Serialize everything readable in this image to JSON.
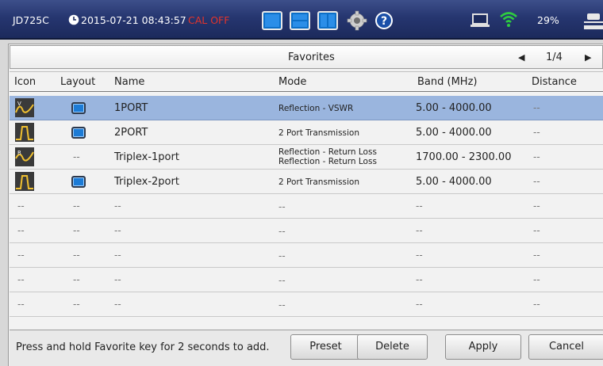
{
  "statusbar": {
    "model": "JD725C",
    "datetime": "2015-07-21 08:43:57",
    "cal_status": "CAL OFF",
    "battery": "29%",
    "icons": [
      "clock-icon",
      "layout-single-icon",
      "layout-split-horizontal-icon",
      "layout-split-vertical-icon",
      "gear-icon",
      "help-icon",
      "laptop-icon",
      "wifi-icon",
      "power-icon"
    ],
    "accent_color": "#1c2a5c",
    "wifi_color": "#2ecc40",
    "cal_color": "#e3342b"
  },
  "favorites": {
    "title": "Favorites",
    "page": "1/4"
  },
  "table": {
    "headers": [
      "Icon",
      "Layout",
      "Name",
      "Mode",
      "Band (MHz)",
      "Distance"
    ],
    "rows": [
      {
        "icon": "vswr-icon",
        "layout": "single",
        "name": "1PORT",
        "mode": [
          "Reflection - VSWR"
        ],
        "band": "5.00 - 4000.00",
        "distance": "--",
        "selected": true
      },
      {
        "icon": "transmission-icon",
        "layout": "single",
        "name": "2PORT",
        "mode": [
          "2 Port Transmission"
        ],
        "band": "5.00 - 4000.00",
        "distance": "--",
        "selected": false
      },
      {
        "icon": "return-loss-icon",
        "layout": "--",
        "name": "Triplex-1port",
        "mode": [
          "Reflection - Return Loss",
          "Reflection - Return Loss"
        ],
        "band": "1700.00 - 2300.00",
        "distance": "--",
        "selected": false
      },
      {
        "icon": "transmission-icon",
        "layout": "single",
        "name": "Triplex-2port",
        "mode": [
          "2 Port Transmission"
        ],
        "band": "5.00 - 4000.00",
        "distance": "--",
        "selected": false
      },
      {
        "icon": "--",
        "layout": "--",
        "name": "--",
        "mode": [
          "--"
        ],
        "band": "--",
        "distance": "--",
        "selected": false
      },
      {
        "icon": "--",
        "layout": "--",
        "name": "--",
        "mode": [
          "--"
        ],
        "band": "--",
        "distance": "--",
        "selected": false
      },
      {
        "icon": "--",
        "layout": "--",
        "name": "--",
        "mode": [
          "--"
        ],
        "band": "--",
        "distance": "--",
        "selected": false
      },
      {
        "icon": "--",
        "layout": "--",
        "name": "--",
        "mode": [
          "--"
        ],
        "band": "--",
        "distance": "--",
        "selected": false
      },
      {
        "icon": "--",
        "layout": "--",
        "name": "--",
        "mode": [
          "--"
        ],
        "band": "--",
        "distance": "--",
        "selected": false
      }
    ],
    "selected_color": "#9ab5de"
  },
  "footer": {
    "hint": "Press and hold Favorite key for 2 seconds to add.",
    "preset_label": "Preset",
    "delete_label": "Delete",
    "apply_label": "Apply",
    "cancel_label": "Cancel"
  }
}
